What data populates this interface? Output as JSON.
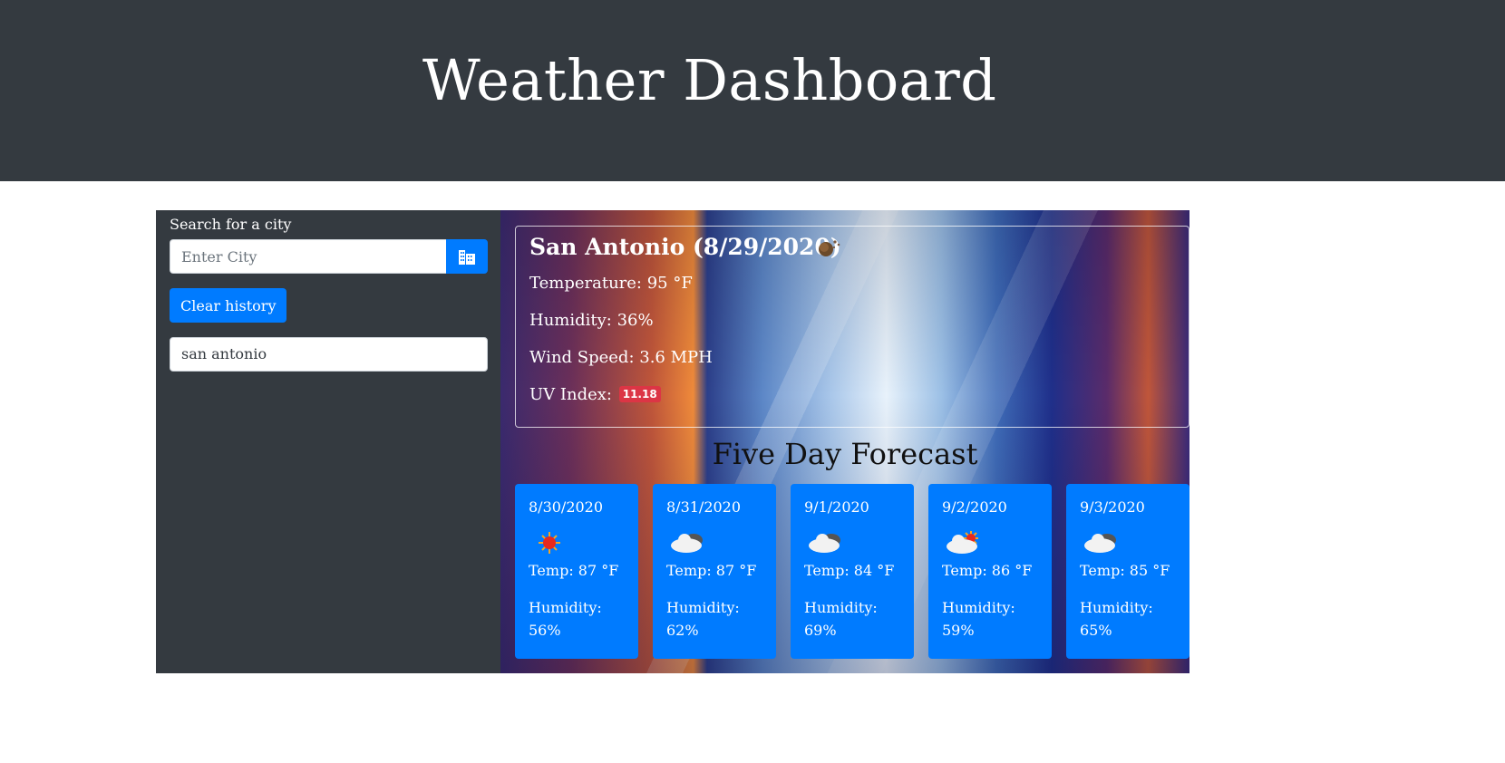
{
  "header": {
    "title": "Weather Dashboard"
  },
  "sidebar": {
    "search_label": "Search for a city",
    "search_placeholder": "Enter City",
    "search_button_icon": "city-icon",
    "clear_label": "Clear history",
    "history": [
      "san antonio"
    ]
  },
  "current": {
    "title": "San Antonio (8/29/2020)",
    "icon": "moon-icon",
    "temperature": "Temperature: 95 °F",
    "humidity": "Humidity: 36%",
    "wind": "Wind Speed: 3.6 MPH",
    "uv_label": "UV Index:",
    "uv_value": "11.18"
  },
  "forecast": {
    "title": "Five Day Forecast",
    "days": [
      {
        "date": "8/30/2020",
        "icon": "sun-icon",
        "temp": "Temp: 87 °F",
        "humidity": "Humidity: 56%"
      },
      {
        "date": "8/31/2020",
        "icon": "cloud-icon",
        "temp": "Temp: 87 °F",
        "humidity": "Humidity: 62%"
      },
      {
        "date": "9/1/2020",
        "icon": "cloud-icon",
        "temp": "Temp: 84 °F",
        "humidity": "Humidity: 69%"
      },
      {
        "date": "9/2/2020",
        "icon": "partly-cloudy-icon",
        "temp": "Temp: 86 °F",
        "humidity": "Humidity: 59%"
      },
      {
        "date": "9/3/2020",
        "icon": "cloud-icon",
        "temp": "Temp: 85 °F",
        "humidity": "Humidity: 65%"
      }
    ]
  },
  "colors": {
    "header_bg": "#343a40",
    "accent": "#007bff",
    "uv_badge": "#dc3545"
  }
}
